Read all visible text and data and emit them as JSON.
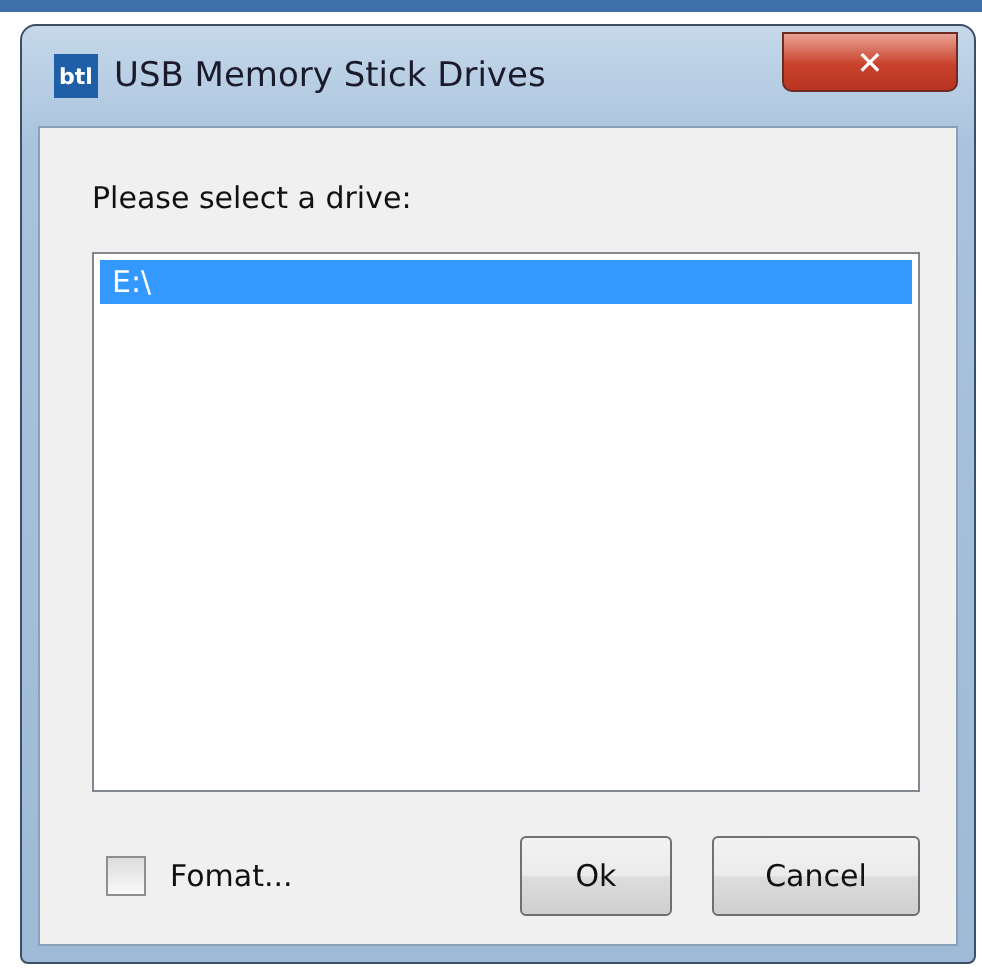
{
  "window": {
    "logo": "btl",
    "title": "USB Memory Stick Drives",
    "close": "✕"
  },
  "prompt": "Please select a drive:",
  "drives": [
    {
      "label": "E:\\",
      "selected": true
    }
  ],
  "format": {
    "label": "Fomat...",
    "checked": false
  },
  "buttons": [
    "Ok",
    "Cancel"
  ]
}
